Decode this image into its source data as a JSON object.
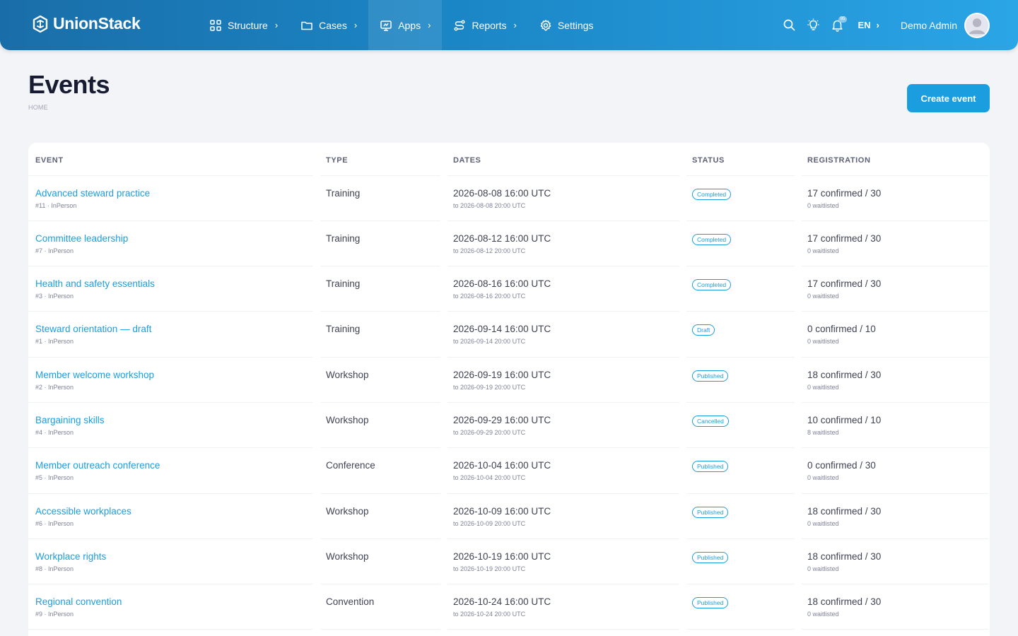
{
  "brand": {
    "name": "UnionStack"
  },
  "nav": [
    {
      "label": "Structure",
      "icon": "grid-icon"
    },
    {
      "label": "Cases",
      "icon": "folder-icon"
    },
    {
      "label": "Apps",
      "icon": "monitor-icon"
    },
    {
      "label": "Reports",
      "icon": "route-icon"
    },
    {
      "label": "Settings",
      "icon": "gear-icon"
    }
  ],
  "header": {
    "notifications_count": "95",
    "language": "EN",
    "user_name": "Demo Admin"
  },
  "page": {
    "title": "Events",
    "breadcrumb": "HOME",
    "create_button": "Create event"
  },
  "table": {
    "headers": [
      "EVENT",
      "TYPE",
      "DATES",
      "STATUS",
      "REGISTRATION"
    ],
    "rows": [
      {
        "name": "Advanced steward practice",
        "meta": "#11 · InPerson",
        "type": "Training",
        "start": "2026-08-08 16:00 UTC",
        "end": "to 2026-08-08 20:00 UTC",
        "status": "Completed",
        "registration": "17 confirmed / 30",
        "waitlisted": "0 waitlisted"
      },
      {
        "name": "Committee leadership",
        "meta": "#7 · InPerson",
        "type": "Training",
        "start": "2026-08-12 16:00 UTC",
        "end": "to 2026-08-12 20:00 UTC",
        "status": "Completed",
        "registration": "17 confirmed / 30",
        "waitlisted": "0 waitlisted"
      },
      {
        "name": "Health and safety essentials",
        "meta": "#3 · InPerson",
        "type": "Training",
        "start": "2026-08-16 16:00 UTC",
        "end": "to 2026-08-16 20:00 UTC",
        "status": "Completed",
        "registration": "17 confirmed / 30",
        "waitlisted": "0 waitlisted"
      },
      {
        "name": "Steward orientation — draft",
        "meta": "#1 · InPerson",
        "type": "Training",
        "start": "2026-09-14 16:00 UTC",
        "end": "to 2026-09-14 20:00 UTC",
        "status": "Draft",
        "registration": "0 confirmed / 10",
        "waitlisted": "0 waitlisted"
      },
      {
        "name": "Member welcome workshop",
        "meta": "#2 · InPerson",
        "type": "Workshop",
        "start": "2026-09-19 16:00 UTC",
        "end": "to 2026-09-19 20:00 UTC",
        "status": "Published",
        "registration": "18 confirmed / 30",
        "waitlisted": "0 waitlisted"
      },
      {
        "name": "Bargaining skills",
        "meta": "#4 · InPerson",
        "type": "Workshop",
        "start": "2026-09-29 16:00 UTC",
        "end": "to 2026-09-29 20:00 UTC",
        "status": "Cancelled",
        "registration": "10 confirmed / 10",
        "waitlisted": "8 waitlisted"
      },
      {
        "name": "Member outreach conference",
        "meta": "#5 · InPerson",
        "type": "Conference",
        "start": "2026-10-04 16:00 UTC",
        "end": "to 2026-10-04 20:00 UTC",
        "status": "Published",
        "registration": "0 confirmed / 30",
        "waitlisted": "0 waitlisted"
      },
      {
        "name": "Accessible workplaces",
        "meta": "#6 · InPerson",
        "type": "Workshop",
        "start": "2026-10-09 16:00 UTC",
        "end": "to 2026-10-09 20:00 UTC",
        "status": "Published",
        "registration": "18 confirmed / 30",
        "waitlisted": "0 waitlisted"
      },
      {
        "name": "Workplace rights",
        "meta": "#8 · InPerson",
        "type": "Workshop",
        "start": "2026-10-19 16:00 UTC",
        "end": "to 2026-10-19 20:00 UTC",
        "status": "Published",
        "registration": "18 confirmed / 30",
        "waitlisted": "0 waitlisted"
      },
      {
        "name": "Regional convention",
        "meta": "#9 · InPerson",
        "type": "Convention",
        "start": "2026-10-24 16:00 UTC",
        "end": "to 2026-10-24 20:00 UTC",
        "status": "Published",
        "registration": "18 confirmed / 30",
        "waitlisted": "0 waitlisted"
      }
    ]
  },
  "colors": {
    "accent": "#1a9ee0",
    "header_dark": "#1a6ea8",
    "header_light": "#2aa5e6",
    "title": "#181c32"
  }
}
